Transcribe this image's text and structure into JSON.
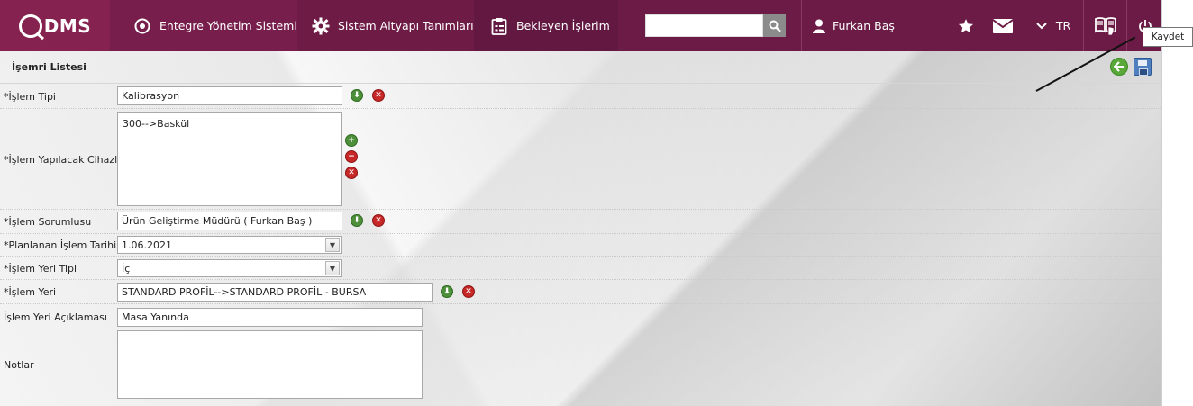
{
  "app": {
    "logo_text": "DMS"
  },
  "nav": {
    "item1": "Entegre Yönetim Sistemi",
    "item2": "Sistem Altyapı Tanımları",
    "item3": "Bekleyen İşlerim"
  },
  "search": {
    "value": ""
  },
  "user": {
    "name": "Furkan Baş"
  },
  "lang": "TR",
  "page": {
    "title": "İşemri Listesi",
    "tooltip": "Kaydet"
  },
  "form": {
    "islem_tipi": {
      "label": "*İşlem Tipi",
      "value": "Kalibrasyon"
    },
    "cihazlar": {
      "label": "*İşlem Yapılacak Cihazlar",
      "items": [
        "300-->Baskül"
      ]
    },
    "sorumlu": {
      "label": "*İşlem Sorumlusu",
      "value": "Ürün Geliştirme Müdürü ( Furkan Baş )"
    },
    "tarih": {
      "label": "*Planlanan İşlem Tarihi",
      "value": "1.06.2021"
    },
    "yer_tipi": {
      "label": "*İşlem Yeri Tipi",
      "value": "İç"
    },
    "yer": {
      "label": "*İşlem Yeri",
      "value": "STANDARD PROFİL-->STANDARD PROFİL - BURSA"
    },
    "yer_aciklama": {
      "label": "İşlem Yeri Açıklaması",
      "value": "Masa Yanında"
    },
    "notlar": {
      "label": "Notlar",
      "value": ""
    }
  },
  "colors": {
    "topbar": "#6b1b45",
    "accent": "#86224f"
  }
}
